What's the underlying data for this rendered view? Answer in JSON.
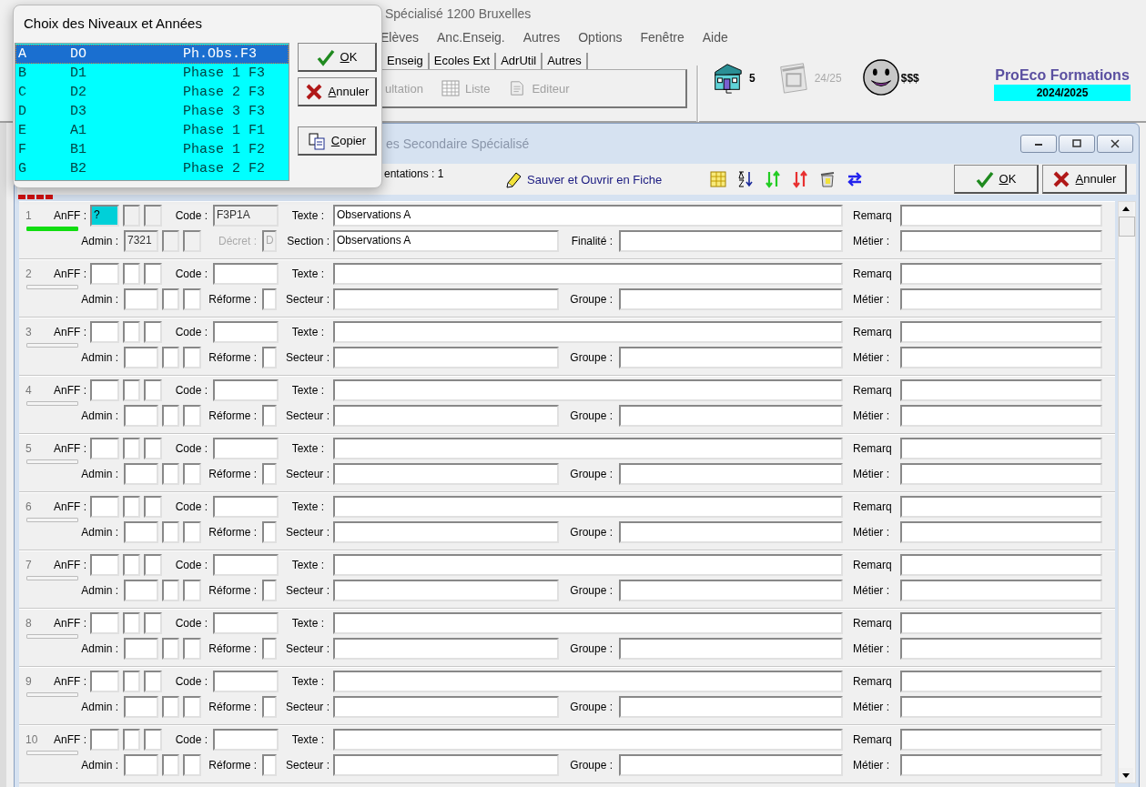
{
  "app": {
    "title": "Spécialisé 1200 Bruxelles",
    "menu": [
      "Elèves",
      "Anc.Enseig.",
      "Autres",
      "Options",
      "Fenêtre",
      "Aide"
    ],
    "tabs": [
      "Enseig",
      "Ecoles Ext",
      "AdrUtil",
      "Autres"
    ],
    "tools": [
      {
        "kind": "none",
        "label": "ultation",
        "disabled": true
      },
      {
        "kind": "list",
        "label": "Liste",
        "disabled": true
      },
      {
        "kind": "editor",
        "label": "Editeur",
        "disabled": true
      }
    ],
    "schools": "5",
    "year": "24/25",
    "money": "$$$",
    "brand": {
      "name": "ProEco Formations",
      "year": "2024/2025"
    }
  },
  "window": {
    "title": "es Secondaire Spécialisé",
    "orientations": "entations : 1",
    "save_link": "Sauver et Ouvrir en Fiche",
    "buttons": [
      {
        "kind": "ok",
        "label": "OK"
      },
      {
        "kind": "cancel",
        "label": "Annuler"
      }
    ]
  },
  "records": [
    {
      "number": "1",
      "active": true,
      "anff_label": "AnFF :",
      "anff": "?",
      "code_label": "Code :",
      "code": "F3P1A",
      "texte_label": "Texte :",
      "texte": "Observations A",
      "remarq_label": "Remarq",
      "admin_label": "Admin :",
      "admin": "7321",
      "flag_label": "Décret :",
      "flag_disabled": true,
      "flag": "D",
      "section_label": "Section :",
      "section": "Observations A",
      "group_label": "Finalité :",
      "metier_label": "Métier :"
    },
    {
      "number": "2",
      "active": false,
      "anff_label": "AnFF :",
      "code_label": "Code :",
      "texte_label": "Texte :",
      "remarq_label": "Remarq",
      "admin_label": "Admin :",
      "flag_label": "Réforme :",
      "flag_disabled": false,
      "section_label": "Secteur :",
      "group_label": "Groupe :",
      "metier_label": "Métier :"
    },
    {
      "number": "3",
      "active": false,
      "anff_label": "AnFF :",
      "code_label": "Code :",
      "texte_label": "Texte :",
      "remarq_label": "Remarq",
      "admin_label": "Admin :",
      "flag_label": "Réforme :",
      "flag_disabled": false,
      "section_label": "Secteur :",
      "group_label": "Groupe :",
      "metier_label": "Métier :"
    },
    {
      "number": "4",
      "active": false,
      "anff_label": "AnFF :",
      "code_label": "Code :",
      "texte_label": "Texte :",
      "remarq_label": "Remarq",
      "admin_label": "Admin :",
      "flag_label": "Réforme :",
      "flag_disabled": false,
      "section_label": "Secteur :",
      "group_label": "Groupe :",
      "metier_label": "Métier :"
    },
    {
      "number": "5",
      "active": false,
      "anff_label": "AnFF :",
      "code_label": "Code :",
      "texte_label": "Texte :",
      "remarq_label": "Remarq",
      "admin_label": "Admin :",
      "flag_label": "Réforme :",
      "flag_disabled": false,
      "section_label": "Secteur :",
      "group_label": "Groupe :",
      "metier_label": "Métier :"
    },
    {
      "number": "6",
      "active": false,
      "anff_label": "AnFF :",
      "code_label": "Code :",
      "texte_label": "Texte :",
      "remarq_label": "Remarq",
      "admin_label": "Admin :",
      "flag_label": "Réforme :",
      "flag_disabled": false,
      "section_label": "Secteur :",
      "group_label": "Groupe :",
      "metier_label": "Métier :"
    },
    {
      "number": "7",
      "active": false,
      "anff_label": "AnFF :",
      "code_label": "Code :",
      "texte_label": "Texte :",
      "remarq_label": "Remarq",
      "admin_label": "Admin :",
      "flag_label": "Réforme :",
      "flag_disabled": false,
      "section_label": "Secteur :",
      "group_label": "Groupe :",
      "metier_label": "Métier :"
    },
    {
      "number": "8",
      "active": false,
      "anff_label": "AnFF :",
      "code_label": "Code :",
      "texte_label": "Texte :",
      "remarq_label": "Remarq",
      "admin_label": "Admin :",
      "flag_label": "Réforme :",
      "flag_disabled": false,
      "section_label": "Secteur :",
      "group_label": "Groupe :",
      "metier_label": "Métier :"
    },
    {
      "number": "9",
      "active": false,
      "anff_label": "AnFF :",
      "code_label": "Code :",
      "texte_label": "Texte :",
      "remarq_label": "Remarq",
      "admin_label": "Admin :",
      "flag_label": "Réforme :",
      "flag_disabled": false,
      "section_label": "Secteur :",
      "group_label": "Groupe :",
      "metier_label": "Métier :"
    },
    {
      "number": "10",
      "active": false,
      "anff_label": "AnFF :",
      "code_label": "Code :",
      "texte_label": "Texte :",
      "remarq_label": "Remarq",
      "admin_label": "Admin :",
      "flag_label": "Réforme :",
      "flag_disabled": false,
      "section_label": "Secteur :",
      "group_label": "Groupe :",
      "metier_label": "Métier :"
    }
  ],
  "dialog": {
    "title": "Choix des Niveaux et Années",
    "items": [
      {
        "letter": "A",
        "code": "DO",
        "phase": "Ph.Obs.F3",
        "selected": true
      },
      {
        "letter": "B",
        "code": "D1",
        "phase": "Phase 1 F3",
        "selected": false
      },
      {
        "letter": "C",
        "code": "D2",
        "phase": "Phase 2 F3",
        "selected": false
      },
      {
        "letter": "D",
        "code": "D3",
        "phase": "Phase 3 F3",
        "selected": false
      },
      {
        "letter": "E",
        "code": "A1",
        "phase": "Phase 1 F1",
        "selected": false
      },
      {
        "letter": "F",
        "code": "B1",
        "phase": "Phase 1 F2",
        "selected": false
      },
      {
        "letter": "G",
        "code": "B2",
        "phase": "Phase 2 F2",
        "selected": false
      }
    ],
    "buttons": [
      {
        "kind": "ok",
        "label": "OK"
      },
      {
        "kind": "cancel",
        "label": "Annuler"
      },
      {
        "kind": "copy",
        "label": "Copier"
      }
    ]
  }
}
